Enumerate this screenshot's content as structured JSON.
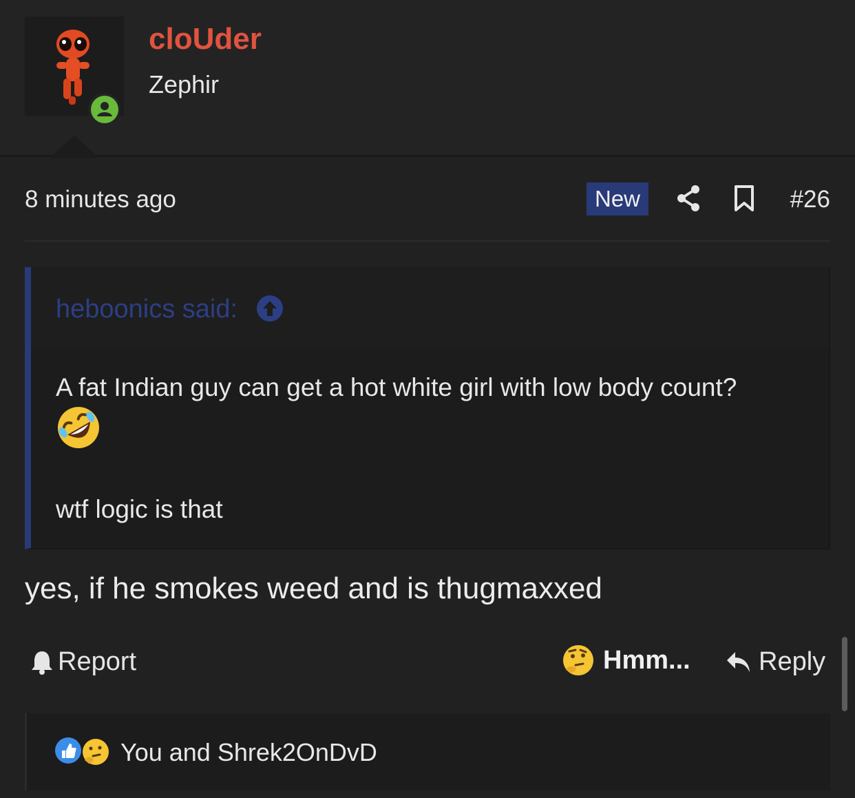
{
  "user": {
    "name": "cloUder",
    "title": "Zephir",
    "status": "online"
  },
  "post": {
    "timestamp": "8 minutes ago",
    "badge": "New",
    "number": "#26",
    "body": "yes, if he smokes weed and is thugmaxxed"
  },
  "quote": {
    "author": "heboonics said:",
    "line1": "A fat Indian guy can get a hot white girl with low body count?",
    "emoji": "rolling-on-floor-laughing",
    "line2": "wtf logic is that"
  },
  "actions": {
    "report_label": "Report",
    "reaction_label": "Hmm...",
    "reply_label": "Reply"
  },
  "reactions": {
    "icons": [
      "like-icon",
      "thinking-icon"
    ],
    "summary": "You and Shrek2OnDvD"
  },
  "colors": {
    "username": "#e0533f",
    "accent": "#283a78",
    "quote_author": "#2c3f85",
    "online": "#69b93b"
  }
}
